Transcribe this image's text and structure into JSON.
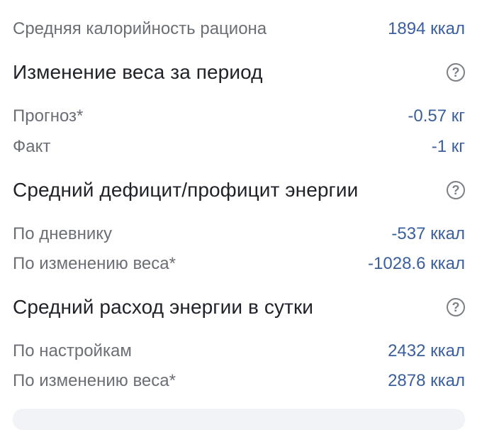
{
  "summary": {
    "avg_calories_label": "Средняя калорийность рациона",
    "avg_calories_value": "1894 ккал"
  },
  "weight_change": {
    "title": "Изменение веса за период",
    "help_icon": "question-circle-icon",
    "forecast_label": "Прогноз*",
    "forecast_value": "-0.57 кг",
    "fact_label": "Факт",
    "fact_value": "-1 кг"
  },
  "energy_balance": {
    "title": "Средний дефицит/профицит энергии",
    "help_icon": "question-circle-icon",
    "diary_label": "По дневнику",
    "diary_value": "-537 ккал",
    "weight_label": "По изменению веса*",
    "weight_value": "-1028.6 ккал"
  },
  "energy_expenditure": {
    "title": "Средний расход энергии в сутки",
    "help_icon": "question-circle-icon",
    "settings_label": "По настройкам",
    "settings_value": "2432 ккал",
    "weight_label": "По изменению веса*",
    "weight_value": "2878 ккал"
  },
  "colors": {
    "value_blue": "#3b5f9c",
    "label_gray": "#6b6f75",
    "title_dark": "#1f2228"
  }
}
